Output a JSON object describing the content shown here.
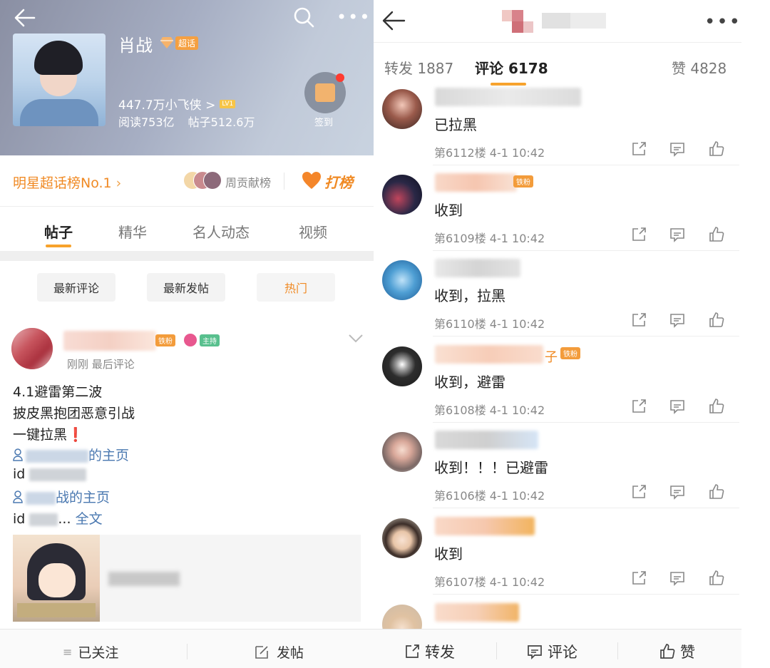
{
  "left": {
    "topic_name": "肖战",
    "super_label": "超话",
    "fans": "447.7万小飞侠 >",
    "level_badge": "LV1",
    "reads": "阅读753亿",
    "posts": "帖子512.6万",
    "checkin_label": "签到",
    "rank_text": "明星超话榜No.1",
    "contrib_label": "周贡献榜",
    "dabang_label": "打榜",
    "tabs": [
      "帖子",
      "精华",
      "名人动态",
      "视频"
    ],
    "filters": [
      "最新评论",
      "最新发帖",
      "热门"
    ],
    "post": {
      "badge_iron": "铁粉",
      "badge_host": "主持",
      "meta": "刚刚 最后评论",
      "line1": "4.1避雷第二波",
      "line2": "披皮黑抱团恶意引战",
      "line3": "一键拉黑",
      "exclaim": "❗",
      "link1_suffix": "的主页",
      "id1_prefix": "id",
      "link2_suffix": "战的主页",
      "id2_prefix": "id",
      "ellipsis": "...",
      "full_text": "全文"
    },
    "bottom": {
      "followed": "已关注",
      "post": "发帖"
    }
  },
  "right": {
    "tabs": {
      "repost": "转发 1887",
      "comments": "评论 6178",
      "likes": "赞 4828"
    },
    "comments": [
      {
        "text": "已拉黑",
        "meta": "第6112楼 4-1 10:42"
      },
      {
        "text": "收到",
        "meta": "第6109楼 4-1 10:42",
        "badge": "铁粉"
      },
      {
        "text": "收到，拉黑",
        "meta": "第6110楼 4-1 10:42"
      },
      {
        "text": "收到，避雷",
        "meta": "第6108楼 4-1 10:42",
        "name_suffix": "子",
        "badge": "铁粉"
      },
      {
        "text": "收到！！！已避雷",
        "meta": "第6106楼 4-1 10:42"
      },
      {
        "text": "收到",
        "meta": "第6107楼 4-1 10:42"
      }
    ],
    "bottom": {
      "repost": "转发",
      "comment": "评论",
      "like": "赞"
    }
  },
  "colors": {
    "accent_orange": "#f08a24",
    "link_blue": "#4a78b0",
    "tab_underline": "#f7a22b"
  }
}
